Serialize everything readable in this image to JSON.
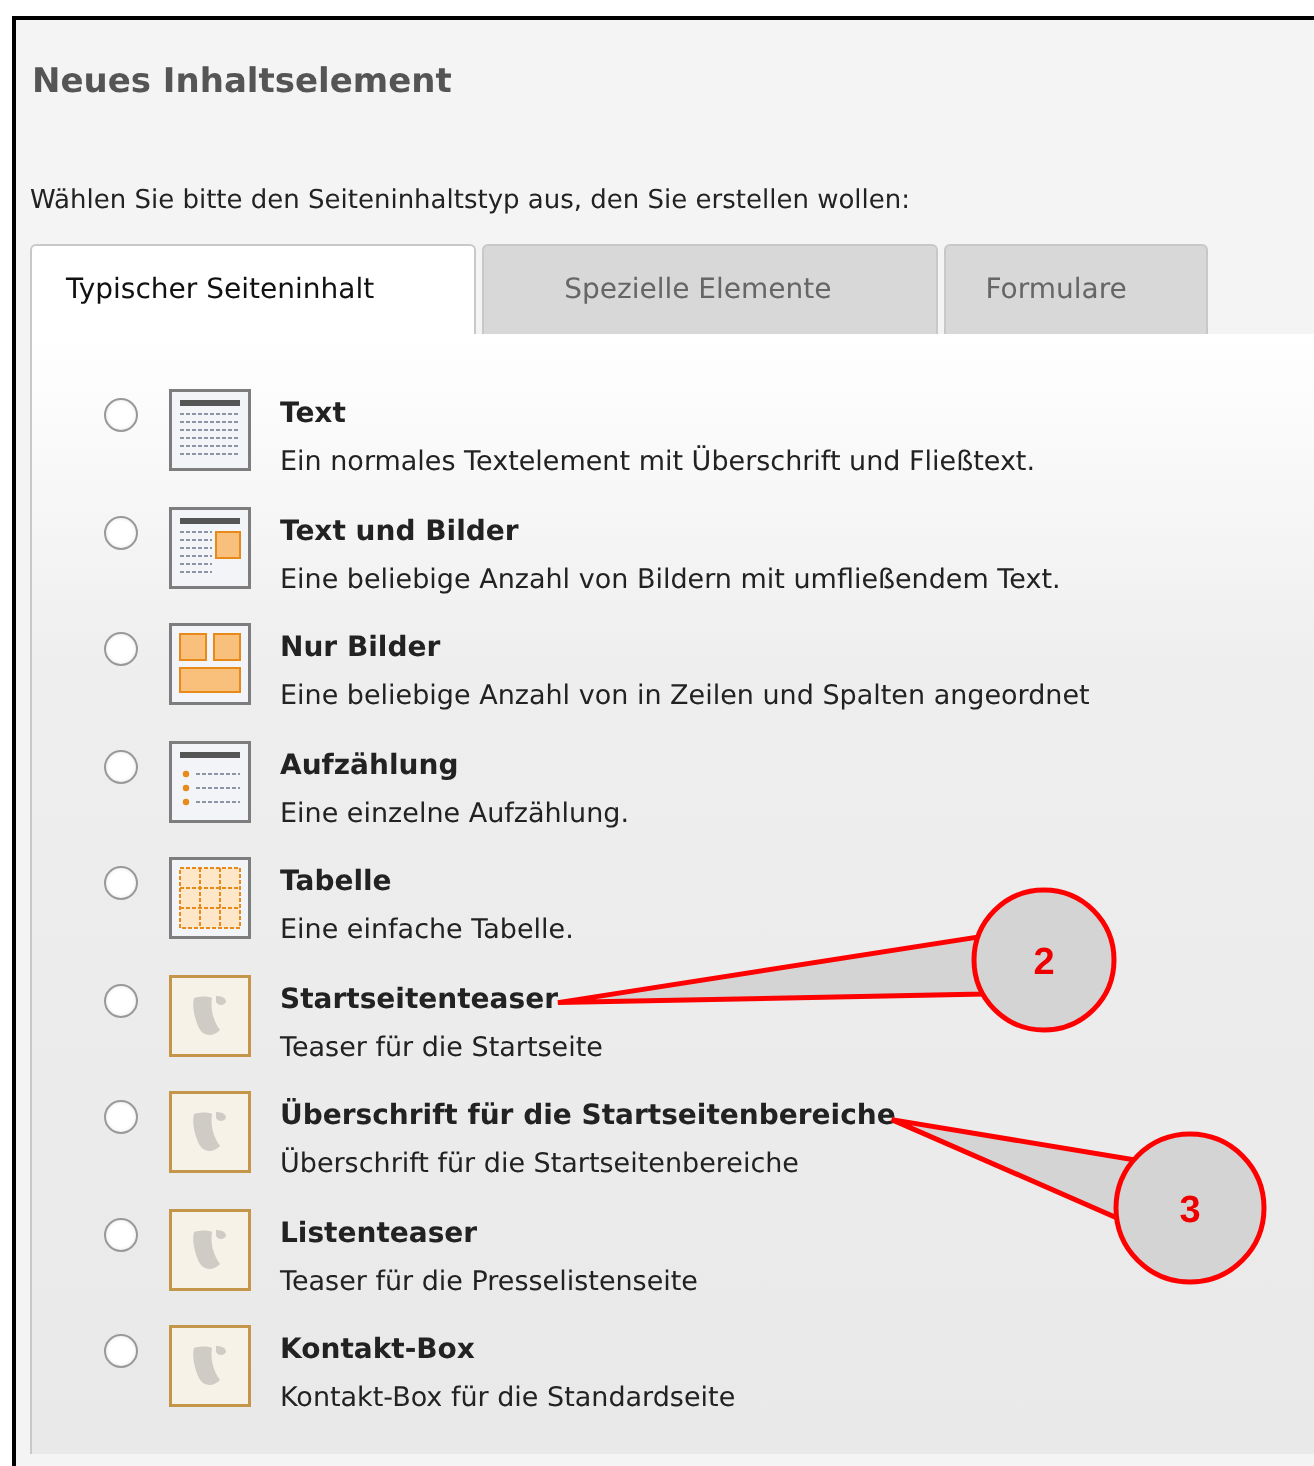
{
  "title": "Neues Inhaltselement",
  "instruction": "Wählen Sie bitte den Seiteninhaltstyp aus, den Sie erstellen wollen:",
  "tabs": [
    {
      "label": "Typischer Seiteninhalt",
      "selected": true
    },
    {
      "label": "Spezielle Elemente",
      "selected": false
    },
    {
      "label": "Formulare",
      "selected": false
    }
  ],
  "items": [
    {
      "kind": "text",
      "title": "Text",
      "description": "Ein normales Textelement mit Überschrift und Fließtext.",
      "checked": false
    },
    {
      "kind": "textpic",
      "title": "Text und Bilder",
      "description": "Eine beliebige Anzahl von Bildern mit umfließendem Text.",
      "checked": false
    },
    {
      "kind": "images",
      "title": "Nur Bilder",
      "description": "Eine beliebige Anzahl von in Zeilen und Spalten angeordnet",
      "checked": false
    },
    {
      "kind": "bullets",
      "title": "Aufzählung",
      "description": "Eine einzelne Aufzählung.",
      "checked": false
    },
    {
      "kind": "table",
      "title": "Tabelle",
      "description": "Eine einfache Tabelle.",
      "checked": false
    },
    {
      "kind": "plugin",
      "title": "Startseitenteaser",
      "description": "Teaser für die Startseite",
      "checked": false
    },
    {
      "kind": "plugin",
      "title": "Überschrift für die Startseitenbereiche",
      "description": "Überschrift für die Startseitenbereiche",
      "checked": false
    },
    {
      "kind": "plugin",
      "title": "Listenteaser",
      "description": "Teaser für die Presselistenseite",
      "checked": false
    },
    {
      "kind": "plugin",
      "title": "Kontakt-Box",
      "description": "Kontakt-Box für die Standardseite",
      "checked": false
    }
  ],
  "callouts": [
    {
      "label": "2"
    },
    {
      "label": "3"
    }
  ]
}
